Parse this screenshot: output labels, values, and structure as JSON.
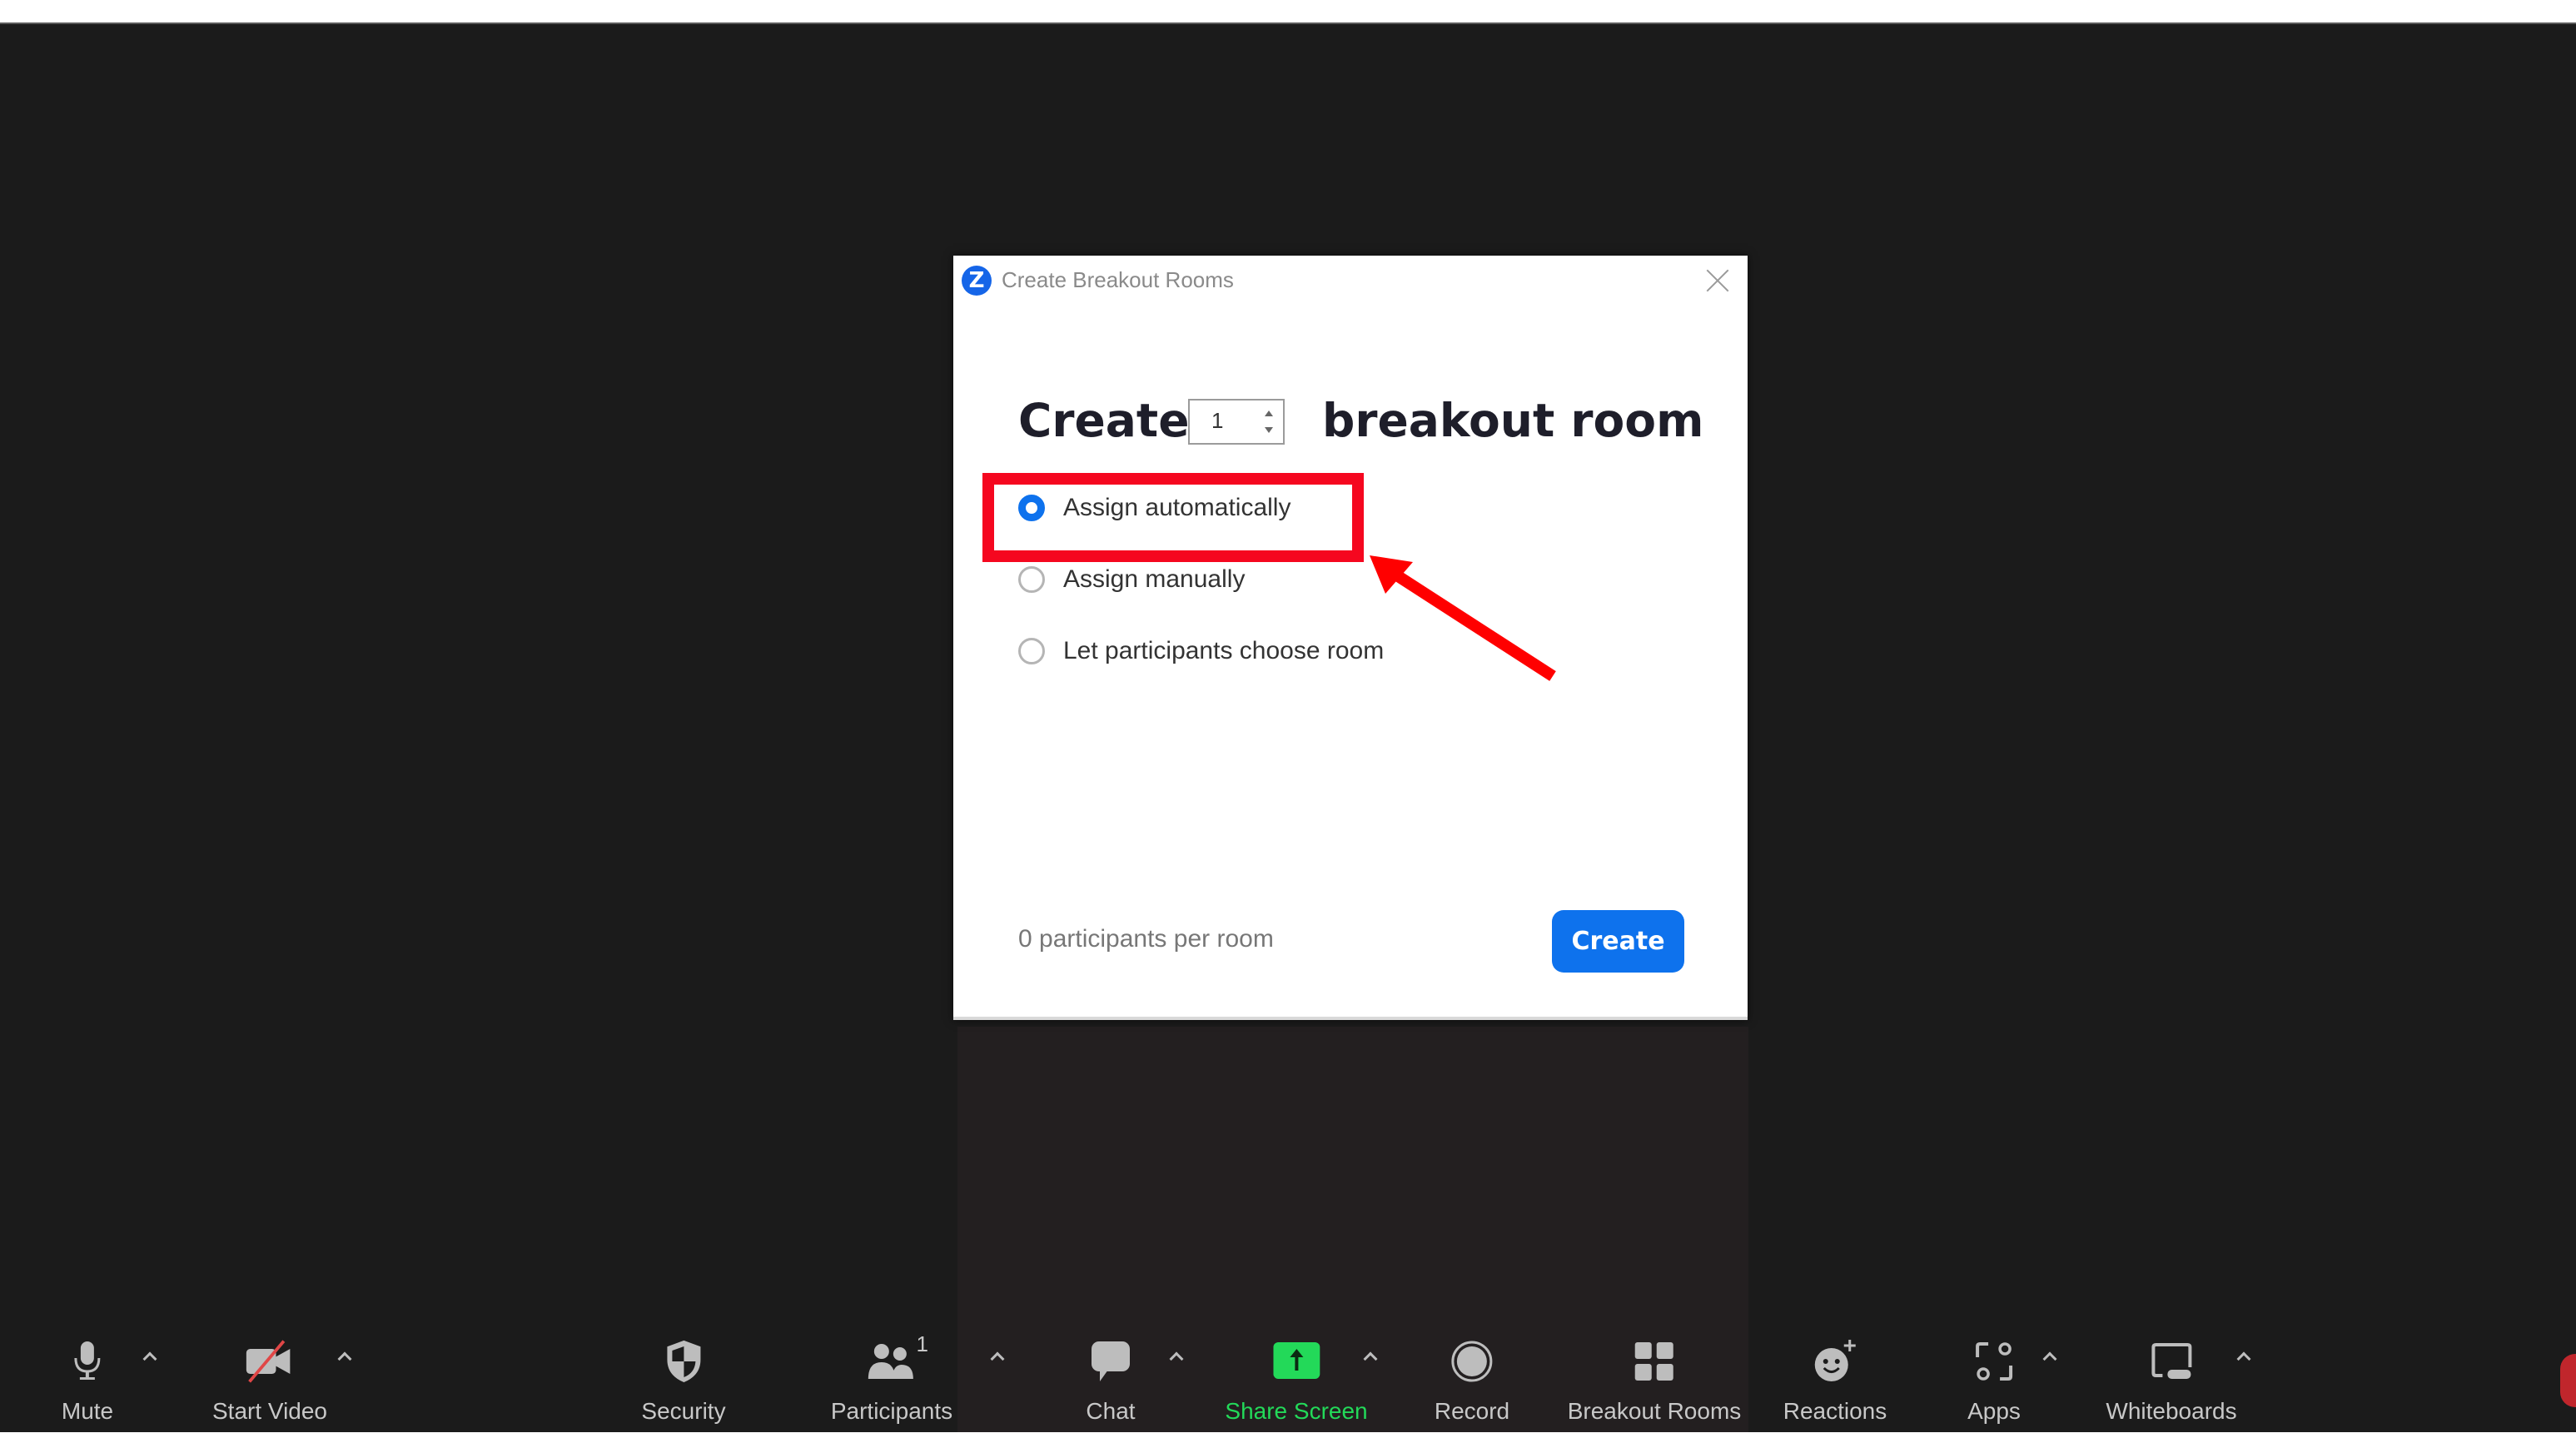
{
  "dialog": {
    "title": "Create Breakout Rooms",
    "logo_letter": "Z",
    "heading_before": "Create",
    "room_count": "1",
    "heading_after": "breakout room",
    "options": [
      {
        "label": "Assign automatically",
        "selected": true
      },
      {
        "label": "Assign manually",
        "selected": false
      },
      {
        "label": "Let participants choose room",
        "selected": false
      }
    ],
    "footer_text": "0 participants per room",
    "create_label": "Create"
  },
  "toolbar": {
    "items": [
      {
        "id": "mute",
        "label": "Mute",
        "icon": "microphone-icon"
      },
      {
        "id": "start-video",
        "label": "Start Video",
        "icon": "video-off-icon"
      },
      {
        "id": "security",
        "label": "Security",
        "icon": "shield-icon"
      },
      {
        "id": "participants",
        "label": "Participants",
        "icon": "participants-icon",
        "count": "1"
      },
      {
        "id": "chat",
        "label": "Chat",
        "icon": "chat-icon"
      },
      {
        "id": "share-screen",
        "label": "Share Screen",
        "icon": "share-screen-icon"
      },
      {
        "id": "record",
        "label": "Record",
        "icon": "record-icon"
      },
      {
        "id": "breakout-rooms",
        "label": "Breakout Rooms",
        "icon": "breakout-rooms-icon"
      },
      {
        "id": "reactions",
        "label": "Reactions",
        "icon": "reactions-icon"
      },
      {
        "id": "apps",
        "label": "Apps",
        "icon": "apps-icon"
      },
      {
        "id": "whiteboards",
        "label": "Whiteboards",
        "icon": "whiteboard-icon"
      }
    ]
  },
  "colors": {
    "accent": "#0e72ed",
    "share_green": "#23d959",
    "annotation_red": "#f5071f",
    "end_red": "#c0262c",
    "background": "#1b1b1b"
  }
}
